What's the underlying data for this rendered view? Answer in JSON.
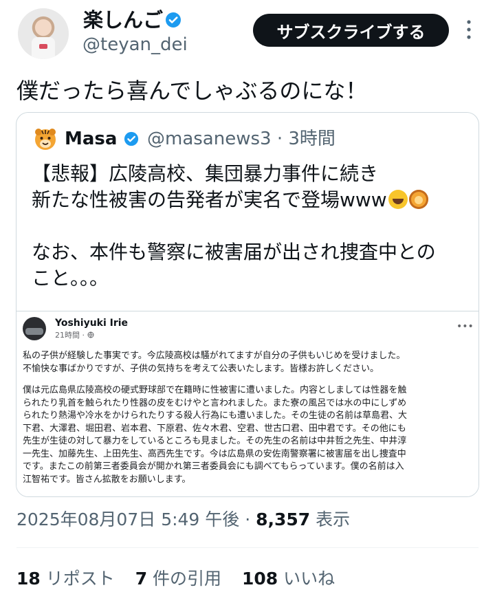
{
  "author": {
    "display_name": "楽しんご",
    "handle": "@teyan_dei",
    "verified_icon": "verified-badge-icon"
  },
  "header": {
    "subscribe_label": "サブスクライブする",
    "more_icon": "more-vertical-icon"
  },
  "post": {
    "text": "僕だったら喜んでしゃぶるのにな！"
  },
  "quote": {
    "avatar_icon": "tiger-emoji-icon",
    "name": "Masa",
    "handle": "@masanews3",
    "time": "3時間",
    "separator": " · ",
    "lines": [
      "【悲報】広陵高校、集団暴力事件に続き",
      "新たな性被害の告発者が実名で登場www",
      "なお、本件も警察に被害届が出され捜査中との",
      "こと。。。"
    ],
    "emojis": [
      "rolling-laughing-emoji",
      "lion-emoji"
    ]
  },
  "embed": {
    "name": "Yoshiyuki Irie",
    "time": "21時間 · ",
    "privacy_icon": "globe-icon",
    "paragraph1": [
      "私の子供が経験した事実です。今広陵高校は騒がれてますが自分の子供もいじめを受けました。",
      "不愉快な事ばかりですが、子供の気持ちを考えて公表いたします。皆様お許しください。"
    ],
    "paragraph2": [
      "僕は元広島県広陵高校の硬式野球部で在籍時に性被害に遭いました。内容としましては性器を触",
      "られたり乳首を触られたり性器の皮をむけやと言われました。また寮の風呂では水の中にしずめ",
      "られたり熱湯や冷水をかけられたりする殺人行為にも遭いました。その生徒の名前は草島君、大",
      "下君、大澤君、堀田君、岩本君、下原君、佐々木君、空君、世古口君、田中君です。その他にも",
      "先生が生徒の対して暴力をしているところも見ました。その先生の名前は中井哲之先生、中井淳",
      "一先生、加藤先生、上田先生、高西先生です。今は広島県の安佐南警察署に被害届を出し捜査中",
      "です。またこの前第三者委員会が開かれ第三者委員会にも調べてもらっています。僕の名前は入",
      "江智祐です。皆さん拡散をお願いします。"
    ]
  },
  "meta": {
    "datetime": "2025年08月07日 5:49 午後",
    "separator": " · ",
    "views_count": "8,357",
    "views_label": " 表示"
  },
  "stats": {
    "reposts_count": "18",
    "reposts_label": " リポスト",
    "quotes_count": "7",
    "quotes_label": " 件の引用",
    "likes_count": "108",
    "likes_label": " いいね"
  },
  "colors": {
    "verified": "#1d9bf0",
    "subscribe_bg": "#0f1419",
    "secondary_text": "#536471",
    "border": "#cfd9de"
  }
}
